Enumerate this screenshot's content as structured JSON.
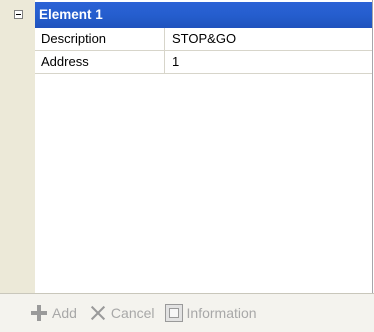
{
  "category": {
    "title": "Element 1",
    "expanded": true
  },
  "properties": [
    {
      "name": "Description",
      "value": "STOP&GO"
    },
    {
      "name": "Address",
      "value": "1"
    }
  ],
  "toolbar": {
    "add_label": "Add",
    "cancel_label": "Cancel",
    "information_label": "Information"
  },
  "icons": {
    "collapse": "minus-box-icon",
    "add": "plus-icon",
    "cancel": "x-icon",
    "information": "info-icon"
  },
  "colors": {
    "header_bg": "#255ece",
    "gutter": "#ece9d8",
    "disabled_text": "#a8a8a8"
  }
}
